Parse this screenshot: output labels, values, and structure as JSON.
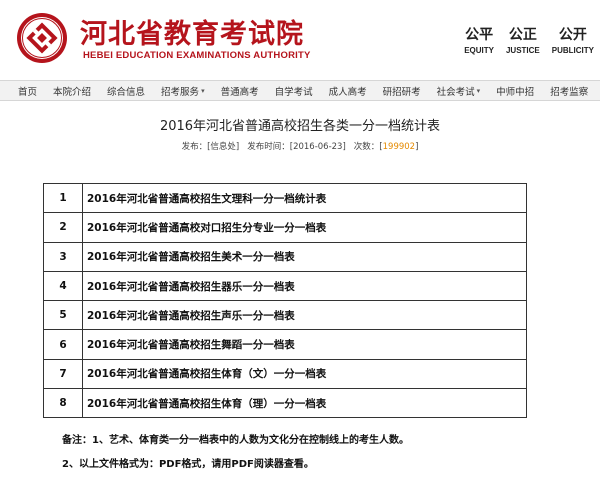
{
  "header": {
    "title": "河北省教育考试院",
    "subtitle": "HEBEI EDUCATION EXAMINATIONS AUTHORITY",
    "values": [
      {
        "cn": "公平",
        "en": "EQUITY"
      },
      {
        "cn": "公正",
        "en": "JUSTICE"
      },
      {
        "cn": "公开",
        "en": "PUBLICITY"
      }
    ],
    "brand_color": "#b5141c"
  },
  "nav": {
    "items": [
      {
        "label": "首页",
        "dropdown": false
      },
      {
        "label": "本院介绍",
        "dropdown": false
      },
      {
        "label": "综合信息",
        "dropdown": false
      },
      {
        "label": "招考服务",
        "dropdown": true
      },
      {
        "label": "普通高考",
        "dropdown": false
      },
      {
        "label": "自学考试",
        "dropdown": false
      },
      {
        "label": "成人高考",
        "dropdown": false
      },
      {
        "label": "研招研考",
        "dropdown": false
      },
      {
        "label": "社会考试",
        "dropdown": true
      },
      {
        "label": "中师中招",
        "dropdown": false
      },
      {
        "label": "招考监察",
        "dropdown": false
      }
    ]
  },
  "article": {
    "title": "2016年河北省普通高校招生各类一分一档统计表",
    "publisher_label": "发布：",
    "publisher": "[信息处]",
    "time_label": "发布时间：",
    "time": "[2016-06-23]",
    "views_label": "次数：",
    "views_open": "[",
    "views": "199902",
    "views_close": "]"
  },
  "files": [
    {
      "num": "1",
      "name": "2016年河北省普通高校招生文理科一分一档统计表"
    },
    {
      "num": "2",
      "name": "2016年河北省普通高校对口招生分专业一分一档表"
    },
    {
      "num": "3",
      "name": "2016年河北省普通高校招生美术一分一档表"
    },
    {
      "num": "4",
      "name": "2016年河北省普通高校招生器乐一分一档表"
    },
    {
      "num": "5",
      "name": "2016年河北省普通高校招生声乐一分一档表"
    },
    {
      "num": "6",
      "name": "2016年河北省普通高校招生舞蹈一分一档表"
    },
    {
      "num": "7",
      "name": "2016年河北省普通高校招生体育（文）一分一档表"
    },
    {
      "num": "8",
      "name": "2016年河北省普通高校招生体育（理）一分一档表"
    }
  ],
  "notes": {
    "line1": "备注：1、艺术、体育类一分一档表中的人数为文化分在控制线上的考生人数。",
    "line2": "2、以上文件格式为：PDF格式，请用PDF阅读器查看。"
  }
}
